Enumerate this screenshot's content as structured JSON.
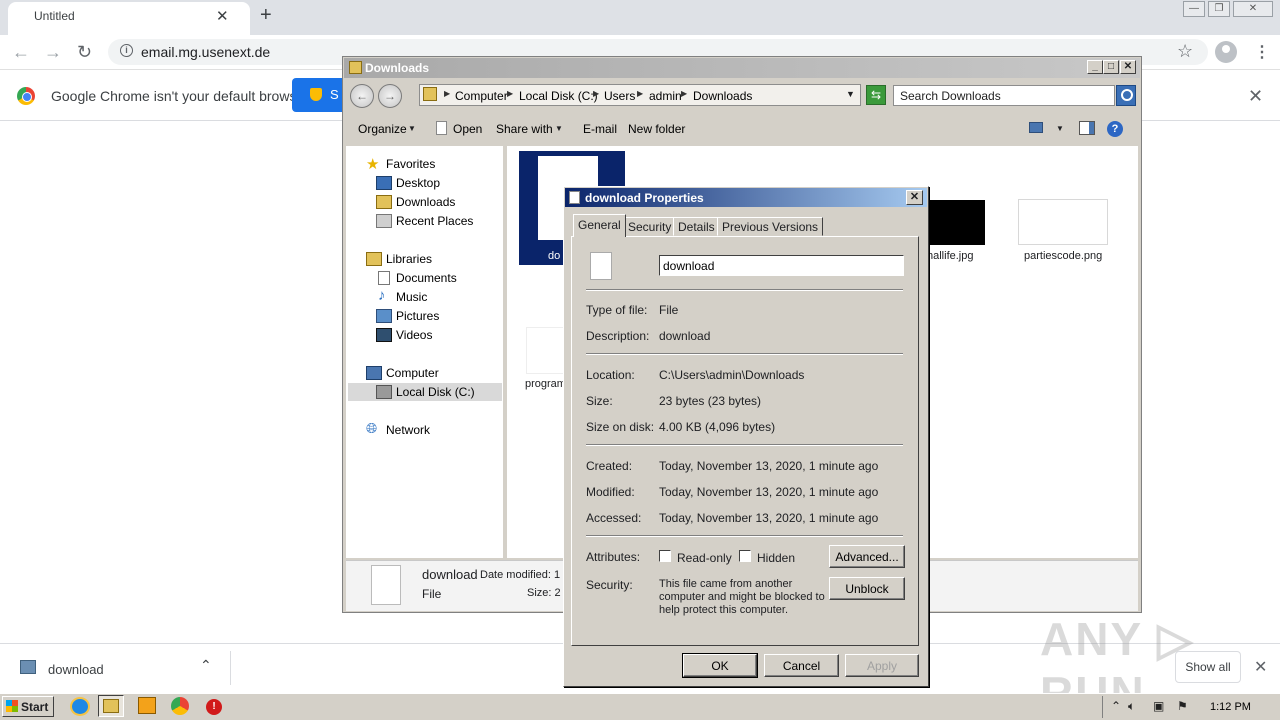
{
  "chrome": {
    "tab_title": "Untitled",
    "tab_close": "✕",
    "new_tab": "+",
    "url": "email.mg.usenext.de",
    "window_buttons": [
      "—",
      "❐",
      "✕"
    ],
    "infobar": {
      "text": "Google Chrome isn't your default browser",
      "button_label": "S",
      "close": "✕"
    },
    "download_shelf": {
      "file_name": "download",
      "show_all": "Show all",
      "close": "✕"
    }
  },
  "watermark": "ANY ▷ RUN",
  "explorer": {
    "title": "Downloads",
    "breadcrumb": [
      "Computer",
      "Local Disk (C:)",
      "Users",
      "admin",
      "Downloads"
    ],
    "search_placeholder": "Search Downloads",
    "commands": {
      "organize": "Organize",
      "open": "Open",
      "share_with": "Share with",
      "email": "E-mail",
      "new_folder": "New folder"
    },
    "nav": {
      "favorites": "Favorites",
      "desktop": "Desktop",
      "downloads": "Downloads",
      "recent_places": "Recent Places",
      "libraries": "Libraries",
      "documents": "Documents",
      "music": "Music",
      "pictures": "Pictures",
      "videos": "Videos",
      "computer": "Computer",
      "local_disk": "Local Disk (C:)",
      "network": "Network"
    },
    "items": {
      "download": "do",
      "hallife": "hallife.jpg",
      "partiescode": "partiescode.png",
      "program": "program"
    },
    "details": {
      "name": "download",
      "modified": "Date modified: 1",
      "type": "File",
      "size": "Size: 2"
    }
  },
  "props": {
    "title": "download Properties",
    "tabs": [
      "General",
      "Security",
      "Details",
      "Previous Versions"
    ],
    "file_name": "download",
    "type_label": "Type of file:",
    "type_value": "File",
    "desc_label": "Description:",
    "desc_value": "download",
    "location_label": "Location:",
    "location_value": "C:\\Users\\admin\\Downloads",
    "size_label": "Size:",
    "size_value": "23 bytes (23 bytes)",
    "size_disk_label": "Size on disk:",
    "size_disk_value": "4.00 KB (4,096 bytes)",
    "created_label": "Created:",
    "created_value": "Today, November 13, 2020, 1 minute ago",
    "modified_label": "Modified:",
    "modified_value": "Today, November 13, 2020, 1 minute ago",
    "accessed_label": "Accessed:",
    "accessed_value": "Today, November 13, 2020, 1 minute ago",
    "attributes_label": "Attributes:",
    "readonly_label": "Read-only",
    "hidden_label": "Hidden",
    "advanced_label": "Advanced...",
    "security_label": "Security:",
    "security_text": "This file came from another computer and might be blocked to help protect this computer.",
    "unblock_label": "Unblock",
    "ok_label": "OK",
    "cancel_label": "Cancel",
    "apply_label": "Apply"
  },
  "taskbar": {
    "start_label": "Start",
    "clock": "1:12 PM"
  }
}
